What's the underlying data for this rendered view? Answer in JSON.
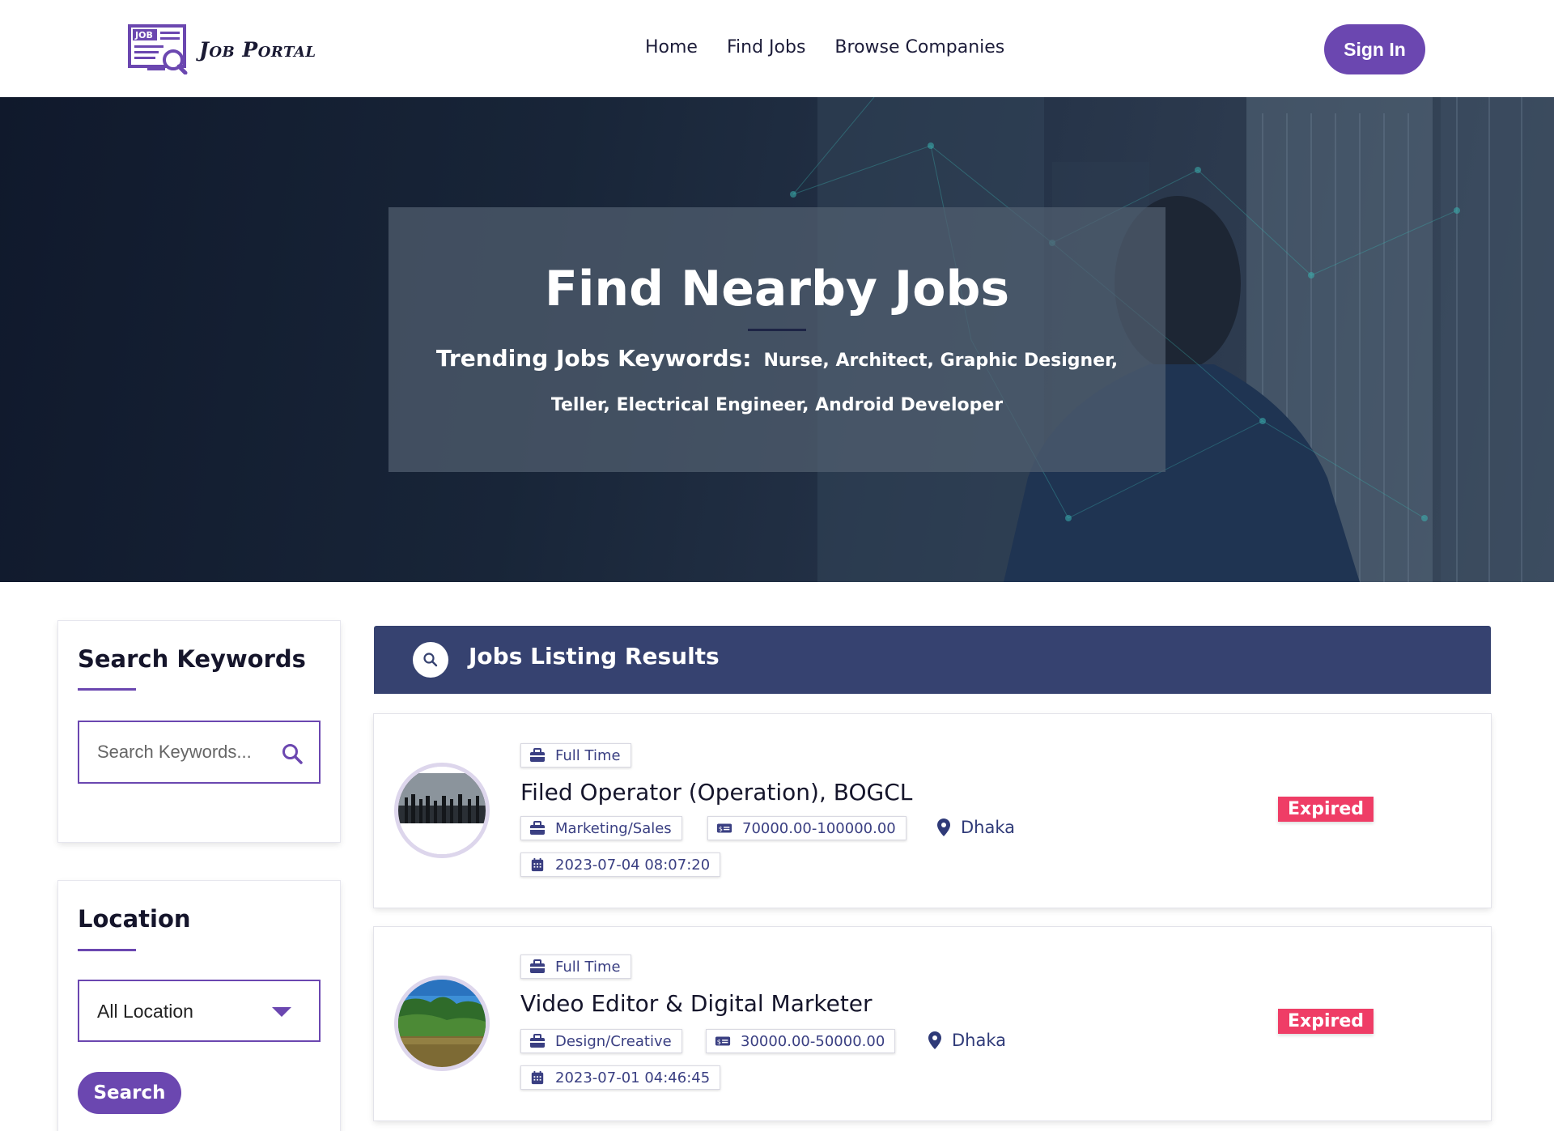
{
  "header": {
    "logo_badge": "JOB",
    "logo_text": "Job Portal",
    "nav": [
      {
        "label": "Home"
      },
      {
        "label": "Find Jobs"
      },
      {
        "label": "Browse Companies"
      }
    ],
    "signin_label": "Sign In"
  },
  "hero": {
    "title": "Find Nearby Jobs",
    "trending_label": "Trending Jobs Keywords:",
    "trending_keywords": "Nurse, Architect, Graphic Designer, Teller, Electrical Engineer, Android Developer"
  },
  "sidebar": {
    "keywords_title": "Search Keywords",
    "keywords_placeholder": "Search Keywords...",
    "location_title": "Location",
    "location_value": "All Location",
    "search_label": "Search"
  },
  "results": {
    "title": "Jobs Listing Results",
    "jobs": [
      {
        "type": "Full Time",
        "title": "Filed Operator (Operation), BOGCL",
        "category": "Marketing/Sales",
        "salary": "70000.00-100000.00",
        "location": "Dhaka",
        "date": "2023-07-04 08:07:20",
        "status": "Expired"
      },
      {
        "type": "Full Time",
        "title": "Video Editor & Digital Marketer",
        "category": "Design/Creative",
        "salary": "30000.00-50000.00",
        "location": "Dhaka",
        "date": "2023-07-01 04:46:45",
        "status": "Expired"
      }
    ]
  },
  "colors": {
    "brand": "#6b47b0",
    "results_bar": "#364270",
    "expired": "#ef3d66",
    "tag_text": "#3a3f82"
  }
}
